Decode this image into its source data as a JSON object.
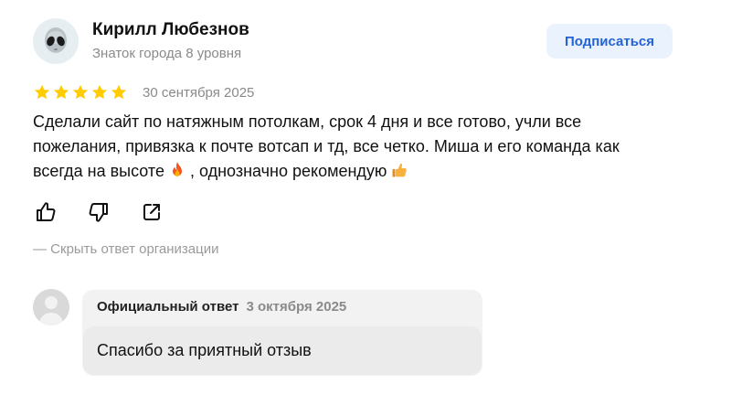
{
  "review": {
    "author": {
      "name": "Кирилл Любезнов",
      "status": "Знаток города 8 уровня",
      "avatar_icon": "alien-face-icon"
    },
    "subscribe_label": "Подписаться",
    "rating": 5,
    "date": "30 сентября 2025",
    "text_part1": "Сделали сайт по натяжным потолкам, срок 4 дня и все готово, учли все пожелания, привязка к почте вотсап и тд, все четко. Миша и его команда как всегда на высоте ",
    "text_part2": " , однозначно рекомендую ",
    "emojis": [
      "fire-emoji",
      "thumbs-up-emoji"
    ],
    "actions": [
      "like-icon",
      "dislike-icon",
      "share-icon"
    ],
    "toggle_reply_label": "— Скрыть ответ организации"
  },
  "org_reply": {
    "avatar_icon": "organization-avatar-icon",
    "label": "Официальный ответ",
    "date": "3 октября 2025",
    "text": "Спасибо за приятный отзыв"
  },
  "colors": {
    "accent": "#2463d6",
    "subscribe_bg": "#eaf2fd",
    "star": "#fc0",
    "muted": "#8a8a8a",
    "reply_bg": "#f2f2f2"
  }
}
